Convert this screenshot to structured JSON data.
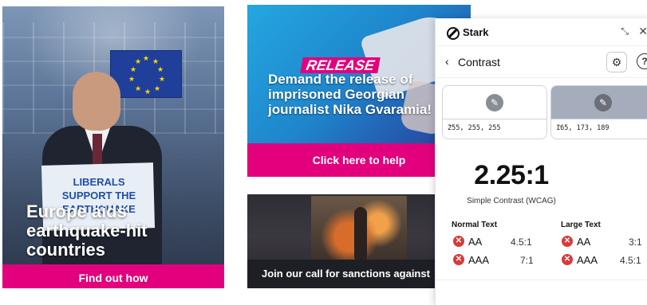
{
  "card1": {
    "sign_text": "LIBERALS SUPPORT THE EARTHQUAKE",
    "headline": "Europe aids earthquake-hit countries",
    "cta": "Find out how"
  },
  "card2": {
    "tag": "RELEASE",
    "headline": "Demand the release of imprisoned Georgian journalist Nika Gvaramia!",
    "cta": "Click here to help"
  },
  "card3": {
    "footer": "Join our call for sanctions against"
  },
  "stark": {
    "app_name": "Stark",
    "nav_title": "Contrast",
    "foreground": {
      "value": "255, 255, 255",
      "color": "#ffffff"
    },
    "background": {
      "value": "165, 173, 189",
      "color": "#a5adbd"
    },
    "ratio": "2.25:1",
    "ratio_label": "Simple Contrast (WCAG)",
    "normal_text": {
      "heading": "Normal Text",
      "aa": "AA",
      "aa_req": "4.5:1",
      "aaa": "AAA",
      "aaa_req": "7:1"
    },
    "large_text": {
      "heading": "Large Text",
      "aa": "AA",
      "aa_req": "3:1",
      "aaa": "AAA",
      "aaa_req": "4.5:1"
    }
  },
  "colors": {
    "magenta": "#e3007d",
    "fail": "#d93a3a"
  }
}
